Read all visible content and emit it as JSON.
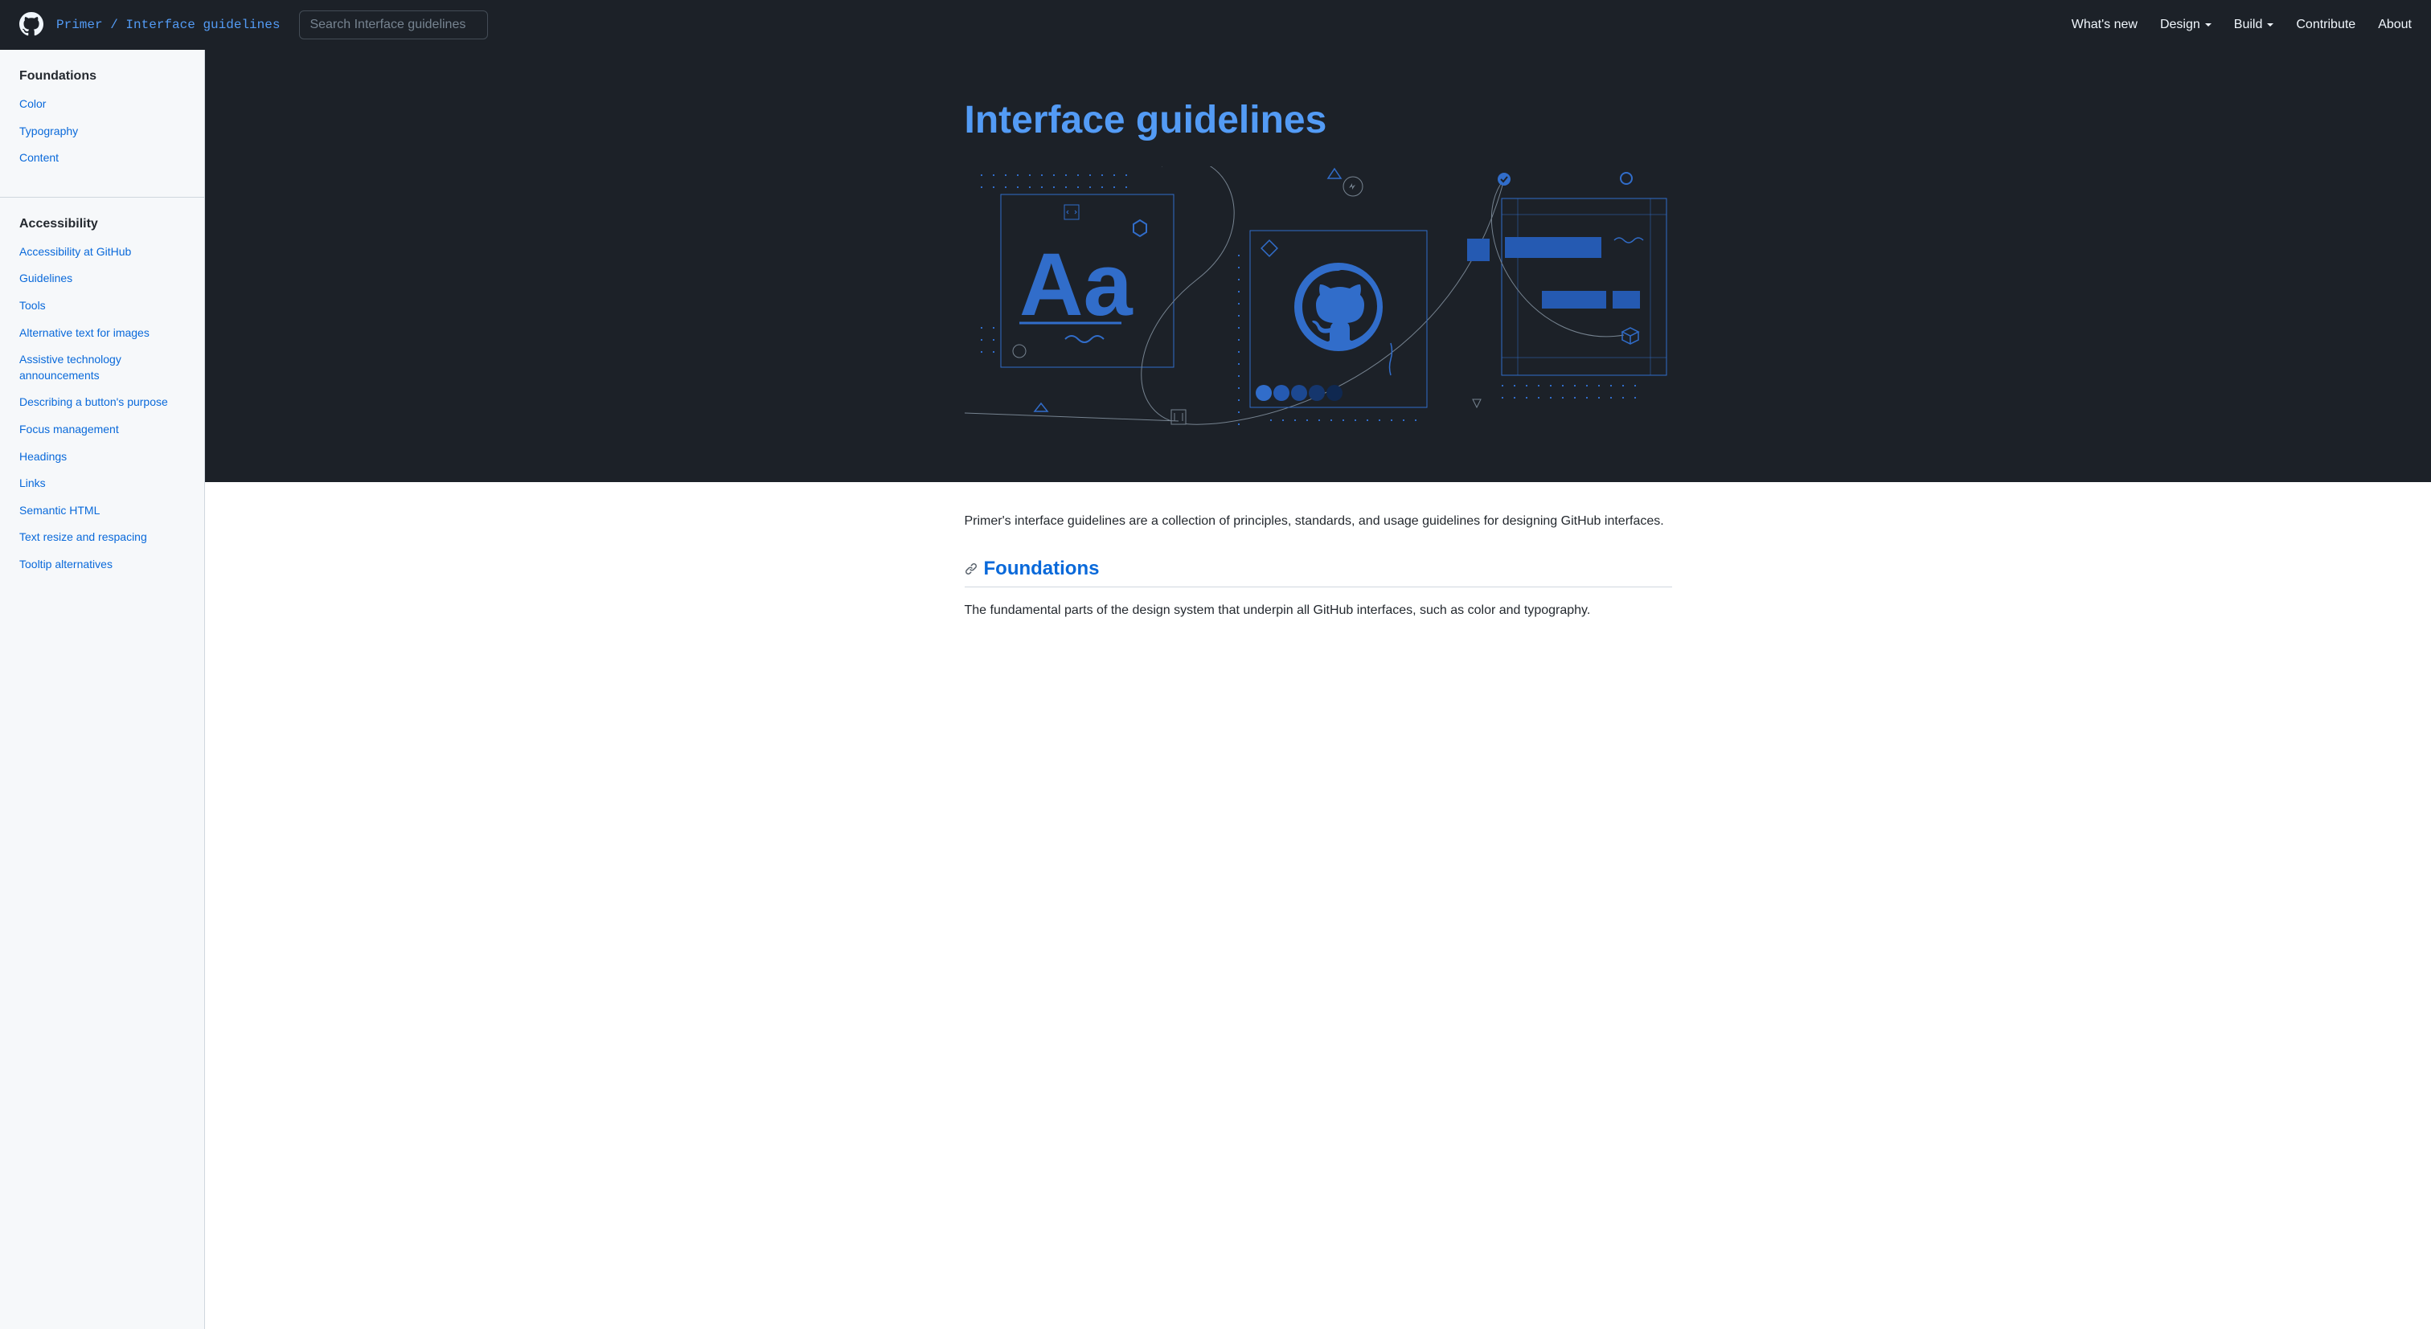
{
  "header": {
    "breadcrumb_primary": "Primer",
    "breadcrumb_separator": " / ",
    "breadcrumb_secondary": "Interface guidelines",
    "search_placeholder": "Search Interface guidelines",
    "nav": {
      "whats_new": "What's new",
      "design": "Design",
      "build": "Build",
      "contribute": "Contribute",
      "about": "About"
    }
  },
  "sidebar": {
    "sections": [
      {
        "heading": "Foundations",
        "items": [
          "Color",
          "Typography",
          "Content"
        ]
      },
      {
        "heading": "Accessibility",
        "items": [
          "Accessibility at GitHub",
          "Guidelines",
          "Tools",
          "Alternative text for images",
          "Assistive technology announcements",
          "Describing a button's purpose",
          "Focus management",
          "Headings",
          "Links",
          "Semantic HTML",
          "Text resize and respacing",
          "Tooltip alternatives"
        ]
      }
    ]
  },
  "main": {
    "hero_title": "Interface guidelines",
    "intro": "Primer's interface guidelines are a collection of principles, standards, and usage guidelines for designing GitHub interfaces.",
    "section": {
      "heading": "Foundations",
      "text": "The fundamental parts of the design system that underpin all GitHub interfaces, such as color and typography."
    }
  },
  "colors": {
    "header_bg": "#1c2128",
    "accent": "#539bf5",
    "link": "#0969da",
    "sidebar_bg": "#f6f8fa",
    "border": "#d0d7de"
  }
}
